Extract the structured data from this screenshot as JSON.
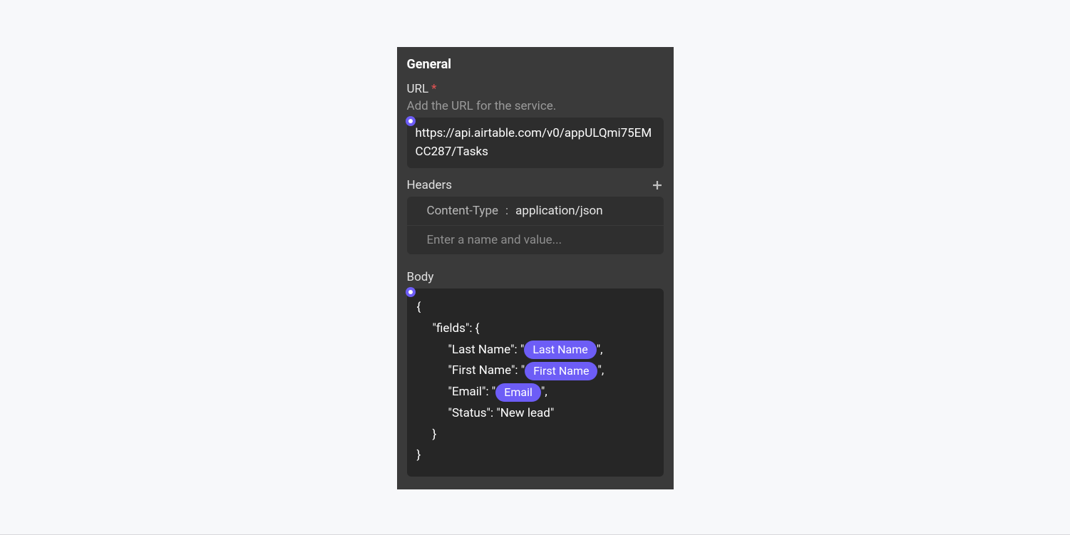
{
  "section_title": "General",
  "url": {
    "label": "URL",
    "required_marker": "*",
    "help": "Add the URL for the service.",
    "value": "https://api.airtable.com/v0/appULQmi75EMCC287/Tasks"
  },
  "headers": {
    "label": "Headers",
    "items": [
      {
        "name": "Content-Type",
        "sep": ":",
        "value": "application/json"
      }
    ],
    "placeholder": "Enter a name and value..."
  },
  "body": {
    "label": "Body",
    "lines": {
      "open": "{",
      "fields_open": "\"fields\": {",
      "last_name_pre": "\"Last Name\": \"",
      "last_name_pill": "Last Name",
      "last_name_post": "\",",
      "first_name_pre": "\"First Name\": \"",
      "first_name_pill": "First Name",
      "first_name_post": "\",",
      "email_pre": "\"Email\": \"",
      "email_pill": "Email",
      "email_post": "\",",
      "status_line": "\"Status\": \"New lead\"",
      "fields_close": "}",
      "close": "}"
    }
  }
}
